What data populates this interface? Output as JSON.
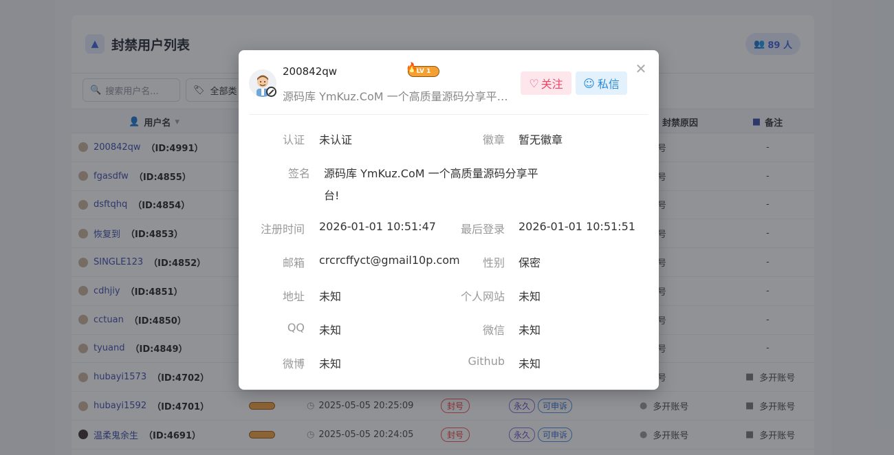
{
  "background": {
    "title": "封禁用户列表",
    "count": "89 人",
    "search_placeholder": "搜索用户名...",
    "filter_label": "全部类",
    "columns": {
      "username": "用户名",
      "reason": "封禁原因",
      "remark": "备注"
    },
    "rows": [
      {
        "name": "200842qw",
        "id": "（ID:4991）",
        "reason": "开账号",
        "remark": "-"
      },
      {
        "name": "fgasdfw",
        "id": "（ID:4855）",
        "reason": "开账号",
        "remark": "-"
      },
      {
        "name": "dsftqhq",
        "id": "（ID:4854）",
        "reason": "开账号",
        "remark": "-"
      },
      {
        "name": "恢复到",
        "id": "（ID:4853）",
        "reason": "开账号",
        "remark": "-"
      },
      {
        "name": "SINGLE123",
        "id": "（ID:4852）",
        "reason": "开账号",
        "remark": "-"
      },
      {
        "name": "cdhjiy",
        "id": "（ID:4851）",
        "reason": "开账号",
        "remark": "-"
      },
      {
        "name": "cctuan",
        "id": "（ID:4850）",
        "reason": "开账号",
        "remark": "-"
      },
      {
        "name": "tyuand",
        "id": "（ID:4849）",
        "reason": "开账号",
        "remark": "-"
      },
      {
        "name": "hubayi1573",
        "id": "（ID:4702）",
        "reason": "开账号",
        "remark": "多开账号"
      },
      {
        "name": "hubayi1592",
        "id": "（ID:4701）",
        "time": "2025-05-05 20:25:09",
        "status": "封号",
        "duration": "永久",
        "appeal": "可申诉",
        "reason": "多开账号",
        "remark": "多开账号"
      },
      {
        "name": "温柔鬼余生",
        "id": "（ID:4691）",
        "time": "2025-05-05 20:24:05",
        "status": "封号",
        "duration": "永久",
        "appeal": "可申诉",
        "reason": "多开账号",
        "remark": "多开账号"
      }
    ]
  },
  "modal": {
    "username": "200842qw",
    "level": "LV 1",
    "signature_short": "源码库 YmKuz.CoM 一个高质量源码分享平台...",
    "follow_label": "关注",
    "message_label": "私信",
    "fields": {
      "auth": {
        "label": "认证",
        "value": "未认证"
      },
      "badge": {
        "label": "徽章",
        "value": "暂无徽章"
      },
      "signature": {
        "label": "签名",
        "value_line1": "源码库 YmKuz.CoM 一个高质量源码分享平",
        "value_line2": "台!"
      },
      "register": {
        "label": "注册时间",
        "value": "2026-01-01 10:51:47"
      },
      "last_login": {
        "label": "最后登录",
        "value": "2026-01-01 10:51:51"
      },
      "email": {
        "label": "邮箱",
        "value": "crcrcffyct@gmail10p.com"
      },
      "gender": {
        "label": "性别",
        "value": "保密"
      },
      "address": {
        "label": "地址",
        "value": "未知"
      },
      "website": {
        "label": "个人网站",
        "value": "未知"
      },
      "qq": {
        "label": "QQ",
        "value": "未知"
      },
      "wechat": {
        "label": "微信",
        "value": "未知"
      },
      "weibo": {
        "label": "微博",
        "value": "未知"
      },
      "github": {
        "label": "Github",
        "value": "未知"
      }
    }
  }
}
